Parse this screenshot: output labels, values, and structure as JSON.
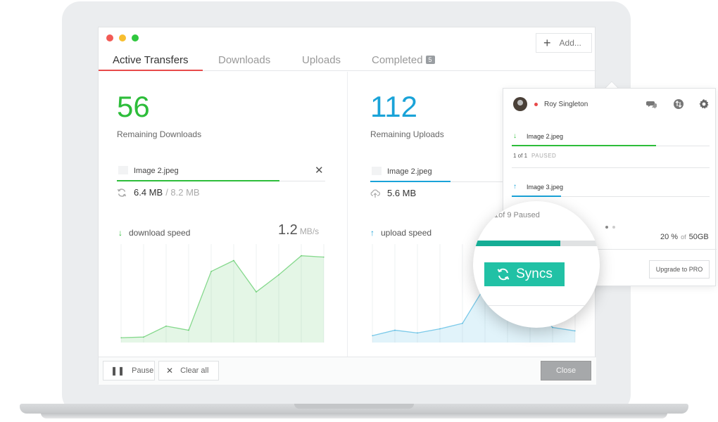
{
  "window": {
    "add_label": "Add...",
    "tabs": [
      {
        "label": "Active Transfers",
        "active": true
      },
      {
        "label": "Downloads"
      },
      {
        "label": "Uploads"
      },
      {
        "label": "Completed",
        "badge": "5"
      }
    ]
  },
  "downloads": {
    "count": "56",
    "count_label": "Remaining Downloads",
    "file": {
      "name": "Image 2.jpeg",
      "done": "6.4 MB",
      "total": "/ 8.2 MB",
      "progress": 0.78
    },
    "speed_label": "download speed",
    "speed_value": "1.2",
    "speed_unit": "MB/s",
    "color": "#2dbd3a"
  },
  "uploads": {
    "count": "112",
    "count_label": "Remaining Uploads",
    "file": {
      "name": "Image 2.jpeg",
      "done": "5.6 MB",
      "progress": 0.6
    },
    "speed_label": "upload speed",
    "color": "#1aa3d8"
  },
  "footer": {
    "pause_label": "Pause",
    "clear_label": "Clear all",
    "close_label": "Close"
  },
  "popup": {
    "user_name": "Roy Singleton",
    "status_color": "#e84a4a",
    "icons": [
      "chat-icon",
      "sync-icon",
      "gear-icon"
    ],
    "items": [
      {
        "name": "Image 2.jpeg",
        "direction": "download",
        "status_count": "1 of 1",
        "status_text": "PAUSED",
        "progress": 0.73
      },
      {
        "name": "Image 3.jpeg",
        "direction": "upload",
        "progress": 0.25
      }
    ],
    "storage_percent": "20 %",
    "storage_of": "of",
    "storage_total": "50GB",
    "upgrade_label": "Upgrade to PRO"
  },
  "magnifier": {
    "paused_text": "1of 9 Paused",
    "sync_label": "Syncs",
    "progress": 0.69,
    "accent": "#21c1a5"
  },
  "chart_data": [
    {
      "type": "area",
      "title": "download speed",
      "x": [
        0,
        1,
        2,
        3,
        4,
        5,
        6,
        7,
        8,
        9
      ],
      "values": [
        0.5,
        0.6,
        2.2,
        1.6,
        10.2,
        11.8,
        7.2,
        9.7,
        12.5,
        12.3
      ],
      "ylim": [
        0,
        14
      ],
      "grid": true,
      "color": "#2dbd3a"
    },
    {
      "type": "area",
      "title": "upload speed",
      "x": [
        0,
        1,
        2,
        3,
        4,
        5,
        6,
        7,
        8,
        9
      ],
      "values": [
        0.8,
        1.6,
        1.2,
        1.8,
        2.6,
        8.0,
        5.0,
        5.5,
        2.0,
        1.5
      ],
      "ylim": [
        0,
        14
      ],
      "grid": true,
      "color": "#1aa3d8"
    }
  ]
}
